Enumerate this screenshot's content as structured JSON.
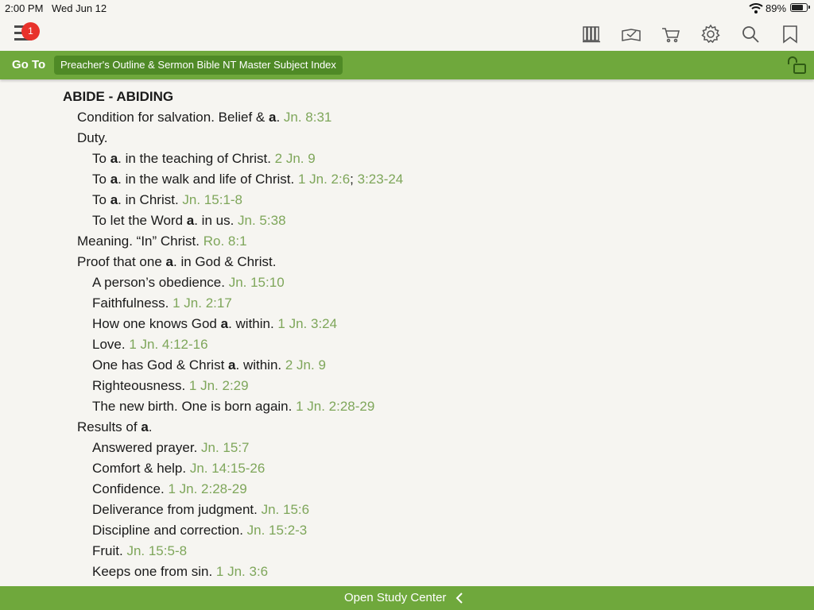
{
  "status": {
    "time": "2:00 PM",
    "date": "Wed Jun 12",
    "battery": "89%",
    "battery_level": 0.89
  },
  "toolbar": {
    "badge": "1",
    "icons": [
      "library-icon",
      "reading-plan-icon",
      "cart-icon",
      "settings-icon",
      "search-icon",
      "bookmark-icon"
    ]
  },
  "goto": {
    "label": "Go To",
    "book": "Preacher's Outline & Sermon Bible NT Master Subject Index"
  },
  "index": {
    "heading": "ABIDE - ABIDING",
    "l1_text": "Condition for salvation. Belief & ",
    "l1_bold": "a",
    "l1_after": ". ",
    "l1_ref": "Jn. 8:31",
    "l2_text": "Duty.",
    "l3_pre": "To ",
    "l3_bold": "a",
    "l3_text": ". in the teaching of Christ. ",
    "l3_ref": "2 Jn. 9",
    "l4_pre": "To ",
    "l4_bold": "a",
    "l4_text": ". in the walk and life of Christ. ",
    "l4_ref": "1 Jn. 2:6",
    "l4_sep": "; ",
    "l4_ref2": "3:23-24",
    "l5_pre": "To ",
    "l5_bold": "a",
    "l5_text": ". in Christ. ",
    "l5_ref": "Jn. 15:1-8",
    "l6_pre": "To let the Word ",
    "l6_bold": "a",
    "l6_text": ". in us. ",
    "l6_ref": "Jn. 5:38",
    "l7_text": "Meaning. “In” Christ. ",
    "l7_ref": "Ro. 8:1",
    "l8_pre": "Proof that one ",
    "l8_bold": "a",
    "l8_text": ". in God & Christ.",
    "l9_text": "A person’s obedience. ",
    "l9_ref": "Jn. 15:10",
    "l10_text": "Faithfulness. ",
    "l10_ref": "1 Jn. 2:17",
    "l11_pre": "How one knows God ",
    "l11_bold": "a",
    "l11_text": ". within. ",
    "l11_ref": "1 Jn. 3:24",
    "l12_text": "Love. ",
    "l12_ref": "1 Jn. 4:12-16",
    "l13_pre": "One has God & Christ ",
    "l13_bold": "a",
    "l13_text": ". within. ",
    "l13_ref": "2 Jn. 9",
    "l14_text": "Righteousness. ",
    "l14_ref": "1 Jn. 2:29",
    "l15_text": "The new birth. One is born again. ",
    "l15_ref": "1 Jn. 2:28-29",
    "l16_pre": "Results of ",
    "l16_bold": "a",
    "l16_text": ".",
    "l17_text": "Answered prayer. ",
    "l17_ref": "Jn. 15:7",
    "l18_text": "Comfort & help. ",
    "l18_ref": "Jn. 14:15-26",
    "l19_text": "Confidence. ",
    "l19_ref": "1 Jn. 2:28-29",
    "l20_text": "Deliverance from judgment. ",
    "l20_ref": "Jn. 15:6",
    "l21_text": "Discipline and correction. ",
    "l21_ref": "Jn. 15:2-3",
    "l22_text": "Fruit. ",
    "l22_ref": "Jn. 15:5-8",
    "l23_text": "Keeps one from sin. ",
    "l23_ref": "1 Jn. 3:6"
  },
  "bottom": {
    "label": "Open Study Center"
  },
  "colors": {
    "accent": "#6fa83c",
    "pill": "#4f8a26",
    "reference": "#7ea65a",
    "badge": "#e8322b"
  }
}
